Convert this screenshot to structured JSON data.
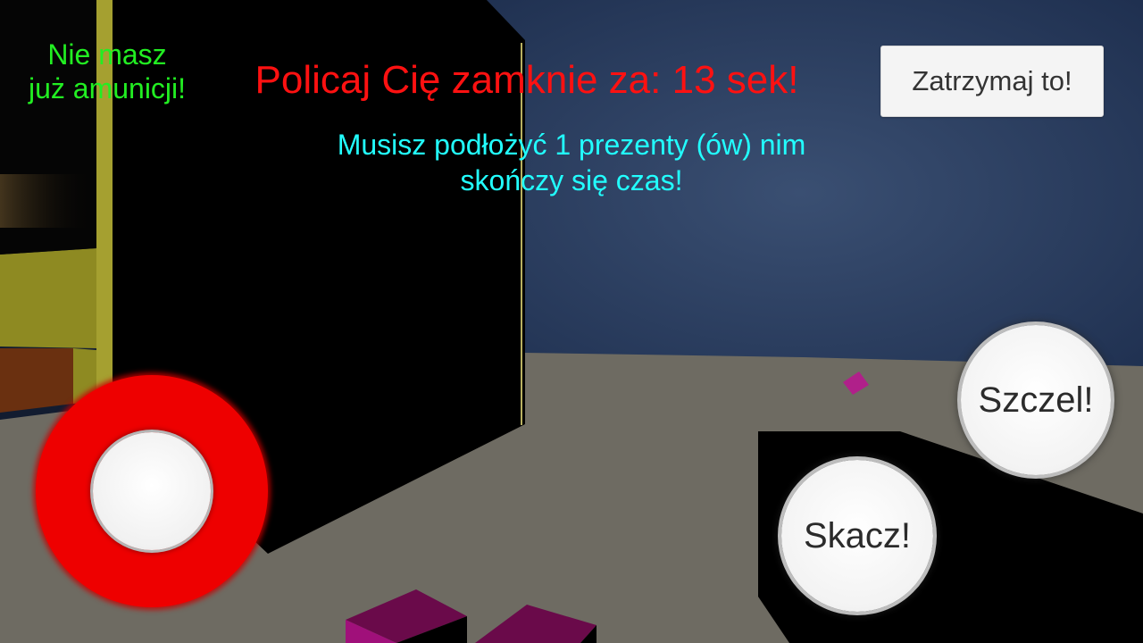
{
  "hud": {
    "ammo_line1": "Nie masz",
    "ammo_line2": "już amunicji!",
    "timer": "Policaj Cię zamknie za: 13 sek!",
    "objective_line1": "Musisz podłożyć 1 prezenty (ów) nim",
    "objective_line2": "skończy się czas!"
  },
  "buttons": {
    "pause": "Zatrzymaj to!",
    "shoot": "Szczel!",
    "jump": "Skacz!"
  },
  "colors": {
    "ammo_text": "#22ee22",
    "timer_text": "#ff1111",
    "objective_text": "#22ffff",
    "joystick_ring": "#ee0000"
  }
}
